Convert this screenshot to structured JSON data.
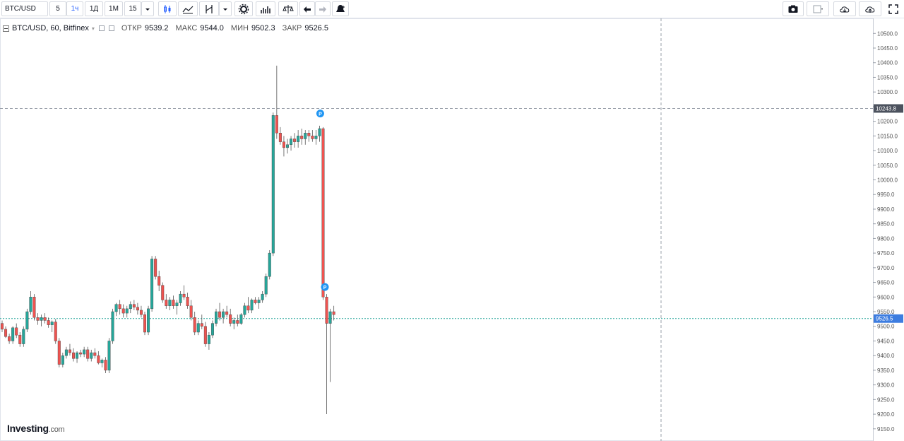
{
  "toolbar": {
    "symbol": "BTC/USD",
    "intervals": [
      "5",
      "1ч",
      "1Д",
      "1М",
      "15"
    ],
    "selected_interval": "1ч"
  },
  "legend": {
    "title": "BTC/USD, 60, Bitfinex",
    "open_label": "ОТКР",
    "open_value": "9539.2",
    "high_label": "МАКС",
    "high_value": "9544.0",
    "low_label": "МИН",
    "low_value": "9502.3",
    "close_label": "ЗАКР",
    "close_value": "9526.5"
  },
  "logo": {
    "text": "Investing",
    "suffix": ".com"
  },
  "colors": {
    "up": "#26a69a",
    "down": "#ef5350",
    "last_price_bg": "#3d7de0",
    "crosshair_bg": "#4c525e",
    "marker": "#2196f3"
  },
  "icons": [
    "candles-icon",
    "line-chart-icon",
    "indicator-icon",
    "dropdown-icon",
    "settings-icon",
    "bar-chart-icon",
    "compare-icon",
    "undo-icon",
    "redo-icon",
    "alert-icon",
    "camera-icon",
    "layout-icon",
    "cloud-download-icon",
    "cloud-upload-icon",
    "fullscreen-icon"
  ],
  "chart_data": {
    "type": "candlestick",
    "y_ticks": [
      "10500.0",
      "10450.0",
      "10400.0",
      "10350.0",
      "10300.0",
      "10250.0",
      "10200.0",
      "10150.0",
      "10100.0",
      "10050.0",
      "10000.0",
      "9950.0",
      "9900.0",
      "9850.0",
      "9800.0",
      "9750.0",
      "9700.0",
      "9650.0",
      "9600.0",
      "9550.0",
      "9500.0",
      "9450.0",
      "9400.0",
      "9350.0",
      "9300.0",
      "9250.0",
      "9200.0",
      "9150.0"
    ],
    "ylim": [
      9135,
      10520
    ],
    "crosshair_price": "10243.8",
    "last_price": "9526.5",
    "markers": [
      "P",
      "P"
    ],
    "series": [
      {
        "name": "main",
        "values": [
          [
            0,
            9510,
            9520,
            9480,
            9490
          ],
          [
            1,
            9490,
            9500,
            9460,
            9465
          ],
          [
            2,
            9465,
            9475,
            9440,
            9450
          ],
          [
            3,
            9450,
            9500,
            9440,
            9495
          ],
          [
            4,
            9495,
            9510,
            9460,
            9470
          ],
          [
            5,
            9470,
            9480,
            9430,
            9440
          ],
          [
            6,
            9440,
            9500,
            9430,
            9490
          ],
          [
            7,
            9490,
            9560,
            9480,
            9550
          ],
          [
            8,
            9550,
            9620,
            9540,
            9600
          ],
          [
            9,
            9600,
            9610,
            9520,
            9530
          ],
          [
            10,
            9530,
            9545,
            9505,
            9520
          ],
          [
            11,
            9520,
            9540,
            9500,
            9530
          ],
          [
            12,
            9530,
            9545,
            9510,
            9520
          ],
          [
            13,
            9520,
            9530,
            9495,
            9505
          ],
          [
            14,
            9505,
            9520,
            9480,
            9515
          ],
          [
            15,
            9515,
            9525,
            9440,
            9450
          ],
          [
            16,
            9450,
            9460,
            9360,
            9370
          ],
          [
            17,
            9370,
            9410,
            9360,
            9400
          ],
          [
            18,
            9400,
            9430,
            9390,
            9420
          ],
          [
            19,
            9420,
            9440,
            9400,
            9410
          ],
          [
            20,
            9410,
            9425,
            9380,
            9390
          ],
          [
            21,
            9390,
            9415,
            9375,
            9410
          ],
          [
            22,
            9410,
            9420,
            9395,
            9405
          ],
          [
            23,
            9405,
            9430,
            9395,
            9420
          ],
          [
            24,
            9420,
            9430,
            9380,
            9390
          ],
          [
            25,
            9390,
            9420,
            9380,
            9410
          ],
          [
            26,
            9410,
            9425,
            9390,
            9400
          ],
          [
            27,
            9400,
            9415,
            9370,
            9375
          ],
          [
            28,
            9375,
            9390,
            9360,
            9385
          ],
          [
            29,
            9385,
            9395,
            9340,
            9350
          ],
          [
            30,
            9350,
            9460,
            9340,
            9450
          ],
          [
            31,
            9450,
            9560,
            9440,
            9550
          ],
          [
            32,
            9550,
            9580,
            9535,
            9575
          ],
          [
            33,
            9575,
            9590,
            9540,
            9560
          ],
          [
            34,
            9560,
            9575,
            9530,
            9545
          ],
          [
            35,
            9545,
            9570,
            9530,
            9560
          ],
          [
            36,
            9560,
            9585,
            9545,
            9575
          ],
          [
            37,
            9575,
            9590,
            9555,
            9565
          ],
          [
            38,
            9565,
            9580,
            9540,
            9555
          ],
          [
            39,
            9555,
            9570,
            9530,
            9540
          ],
          [
            40,
            9540,
            9550,
            9470,
            9480
          ],
          [
            41,
            9480,
            9570,
            9470,
            9560
          ],
          [
            42,
            9560,
            9740,
            9550,
            9730
          ],
          [
            43,
            9730,
            9740,
            9660,
            9670
          ],
          [
            44,
            9670,
            9690,
            9620,
            9640
          ],
          [
            45,
            9640,
            9650,
            9580,
            9590
          ],
          [
            46,
            9590,
            9610,
            9560,
            9570
          ],
          [
            47,
            9570,
            9600,
            9555,
            9590
          ],
          [
            48,
            9590,
            9605,
            9560,
            9570
          ],
          [
            49,
            9570,
            9590,
            9540,
            9580
          ],
          [
            50,
            9580,
            9620,
            9570,
            9610
          ],
          [
            51,
            9610,
            9640,
            9590,
            9600
          ],
          [
            52,
            9600,
            9615,
            9560,
            9570
          ],
          [
            53,
            9570,
            9590,
            9520,
            9530
          ],
          [
            54,
            9530,
            9550,
            9470,
            9480
          ],
          [
            55,
            9480,
            9520,
            9470,
            9510
          ],
          [
            56,
            9510,
            9540,
            9490,
            9500
          ],
          [
            57,
            9500,
            9515,
            9430,
            9440
          ],
          [
            58,
            9440,
            9480,
            9420,
            9470
          ],
          [
            59,
            9470,
            9520,
            9460,
            9510
          ],
          [
            60,
            9510,
            9560,
            9500,
            9550
          ],
          [
            61,
            9550,
            9580,
            9520,
            9530
          ],
          [
            62,
            9530,
            9560,
            9510,
            9550
          ],
          [
            63,
            9550,
            9570,
            9530,
            9540
          ],
          [
            64,
            9540,
            9560,
            9500,
            9510
          ],
          [
            65,
            9510,
            9530,
            9490,
            9520
          ],
          [
            66,
            9520,
            9540,
            9500,
            9510
          ],
          [
            67,
            9510,
            9545,
            9505,
            9540
          ],
          [
            68,
            9540,
            9580,
            9530,
            9570
          ],
          [
            69,
            9570,
            9600,
            9545,
            9555
          ],
          [
            70,
            9555,
            9595,
            9545,
            9590
          ],
          [
            71,
            9590,
            9600,
            9575,
            9580
          ],
          [
            72,
            9580,
            9600,
            9560,
            9590
          ],
          [
            73,
            9590,
            9620,
            9580,
            9610
          ],
          [
            74,
            9610,
            9680,
            9600,
            9670
          ],
          [
            75,
            9670,
            9760,
            9660,
            9750
          ],
          [
            76,
            9750,
            10230,
            9740,
            10220
          ],
          [
            77,
            10220,
            10390,
            10140,
            10160
          ],
          [
            78,
            10160,
            10180,
            10120,
            10130
          ],
          [
            79,
            10130,
            10150,
            10080,
            10110
          ],
          [
            80,
            10110,
            10140,
            10090,
            10120
          ],
          [
            81,
            10120,
            10150,
            10100,
            10140
          ],
          [
            82,
            10140,
            10160,
            10110,
            10130
          ],
          [
            83,
            10130,
            10170,
            10110,
            10150
          ],
          [
            84,
            10150,
            10175,
            10120,
            10140
          ],
          [
            85,
            10140,
            10170,
            10120,
            10160
          ],
          [
            86,
            10160,
            10170,
            10130,
            10150
          ],
          [
            87,
            10150,
            10170,
            10130,
            10140
          ],
          [
            88,
            10140,
            10170,
            10120,
            10150
          ],
          [
            89,
            10150,
            10185,
            10130,
            10175
          ],
          [
            90,
            10175,
            10180,
            9590,
            9600
          ],
          [
            91,
            9600,
            9610,
            9200,
            9510
          ],
          [
            92,
            9510,
            9560,
            9310,
            9550
          ],
          [
            93,
            9550,
            9570,
            9520,
            9540
          ]
        ]
      }
    ]
  }
}
